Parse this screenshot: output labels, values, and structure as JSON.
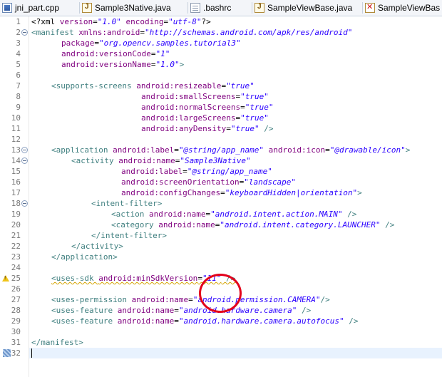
{
  "tabs": [
    {
      "label": "jni_part.cpp",
      "icon": "cpp-file-icon",
      "width": 112
    },
    {
      "label": "Sample3Native.java",
      "icon": "java-file-icon",
      "width": 152
    },
    {
      "label": ".bashrc",
      "icon": "text-file-icon",
      "width": 90
    },
    {
      "label": "SampleViewBase.java",
      "icon": "java-file-icon",
      "width": 155
    },
    {
      "label": "SampleViewBas",
      "icon": "java-error-file-icon",
      "width": 111
    }
  ],
  "editor": {
    "line_numbers": [
      "1",
      "2",
      "3",
      "4",
      "5",
      "6",
      "7",
      "8",
      "9",
      "10",
      "11",
      "12",
      "13",
      "14",
      "15",
      "16",
      "17",
      "18",
      "19",
      "20",
      "21",
      "22",
      "23",
      "24",
      "25",
      "26",
      "27",
      "28",
      "29",
      "30",
      "31",
      "32"
    ],
    "lines": {
      "l1": {
        "a": "<?xml ",
        "b": "version",
        "c": "=",
        "d": "\"1.0\"",
        "e": " ",
        "f": "encoding",
        "g": "=",
        "h": "\"utf-8\"",
        "i": "?>"
      },
      "l2": {
        "a": "<manifest ",
        "b": "xmlns:android",
        "c": "=",
        "d": "\"http://schemas.android.com/apk/res/android\""
      },
      "l3": {
        "b": "package",
        "c": "=",
        "d": "\"org.opencv.samples.tutorial3\""
      },
      "l4": {
        "b": "android:versionCode",
        "c": "=",
        "d": "\"1\""
      },
      "l5": {
        "b": "android:versionName",
        "c": "=",
        "d": "\"1.0\"",
        "e": ">"
      },
      "l7": {
        "a": "<supports-screens ",
        "b": "android:resizeable",
        "c": "=",
        "d": "\"true\""
      },
      "l8": {
        "b": "android:smallScreens",
        "c": "=",
        "d": "\"true\""
      },
      "l9": {
        "b": "android:normalScreens",
        "c": "=",
        "d": "\"true\""
      },
      "l10": {
        "b": "android:largeScreens",
        "c": "=",
        "d": "\"true\""
      },
      "l11": {
        "b": "android:anyDensity",
        "c": "=",
        "d": "\"true\"",
        "e": " />"
      },
      "l13": {
        "a": "<application ",
        "b": "android:label",
        "c": "=",
        "d": "\"@string/app_name\"",
        "f": "android:icon",
        "g": "=",
        "h": "\"@drawable/icon\"",
        "i": ">"
      },
      "l14": {
        "a": "<activity ",
        "b": "android:name",
        "c": "=",
        "d": "\"Sample3Native\""
      },
      "l15": {
        "b": "android:label",
        "c": "=",
        "d": "\"@string/app_name\""
      },
      "l16": {
        "b": "android:screenOrientation",
        "c": "=",
        "d": "\"landscape\""
      },
      "l17": {
        "b": "android:configChanges",
        "c": "=",
        "d": "\"keyboardHidden|orientation\"",
        "e": ">"
      },
      "l18": {
        "a": "<intent-filter>"
      },
      "l19": {
        "a": "<action ",
        "b": "android:name",
        "c": "=",
        "d": "\"android.intent.action.MAIN\"",
        "e": " />"
      },
      "l20": {
        "a": "<category ",
        "b": "android:name",
        "c": "=",
        "d": "\"android.intent.category.LAUNCHER\"",
        "e": " />"
      },
      "l21": {
        "a": "</intent-filter>"
      },
      "l22": {
        "a": "</activity>"
      },
      "l23": {
        "a": "</application>"
      },
      "l25": {
        "a": "<uses-sdk ",
        "b": "android:minSdkVersion",
        "c": "=",
        "d": "\"11\"",
        "e": " />"
      },
      "l27": {
        "a": "<uses-permission ",
        "b": "android:name",
        "c": "=",
        "d": "\"android.permission.CAMERA\"",
        "e": "/>"
      },
      "l28": {
        "a": "<uses-feature ",
        "b": "android:name",
        "c": "=",
        "d": "\"android.hardware.camera\"",
        "e": " />"
      },
      "l29": {
        "a": "<uses-feature ",
        "b": "android:name",
        "c": "=",
        "d": "\"android.hardware.camera.autofocus\"",
        "e": " />"
      },
      "l31": {
        "a": "</manifest>"
      }
    }
  },
  "colors": {
    "tag": "#3f7f7f",
    "attribute": "#7f007f",
    "value": "#2a00ff",
    "annotation_circle": "#e3001b",
    "warning": "#f0c419"
  }
}
